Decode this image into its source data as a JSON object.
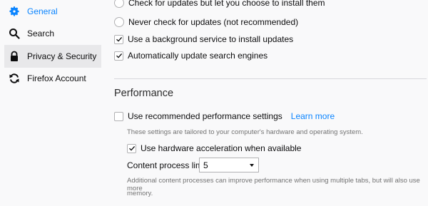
{
  "sidebar": {
    "items": [
      {
        "label": "General",
        "icon": "gear-icon"
      },
      {
        "label": "Search",
        "icon": "search-icon"
      },
      {
        "label": "Privacy & Security",
        "icon": "lock-icon"
      },
      {
        "label": "Firefox Account",
        "icon": "sync-icon"
      }
    ]
  },
  "updates": {
    "option_check": "Check for updates but let you choose to install them",
    "option_never": "Never check for updates (not recommended)",
    "background_service": "Use a background service to install updates",
    "auto_update_search": "Automatically update search engines"
  },
  "performance": {
    "title": "Performance",
    "recommended_label": "Use recommended performance settings",
    "learn_more": "Learn more",
    "tailored_note": "These settings are tailored to your computer's hardware and operating system.",
    "hw_accel_label": "Use hardware acceleration when available",
    "content_process_label": "Content process limit",
    "content_process_value": "5",
    "content_process_note_1": "Additional content processes can improve performance when using multiple tabs, but will also use more",
    "content_process_note_2": "memory."
  },
  "colors": {
    "accent": "#0a84ff",
    "selected_bg": "#e8e8ea"
  }
}
